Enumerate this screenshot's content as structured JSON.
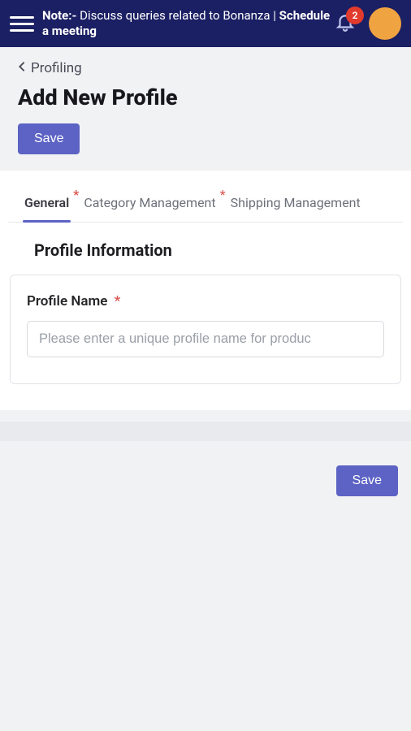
{
  "topbar": {
    "note_prefix": "Note:- ",
    "note_text": "Discuss queries related to Bonanza | ",
    "schedule_label": "Schedule a meeting",
    "notification_count": "2"
  },
  "breadcrumb": {
    "label": "Profiling"
  },
  "page": {
    "title": "Add New Profile"
  },
  "buttons": {
    "save": "Save"
  },
  "tabs": [
    {
      "label": "General",
      "required": true,
      "active": true
    },
    {
      "label": "Category Management",
      "required": true,
      "active": false
    },
    {
      "label": "Shipping Management",
      "required": false,
      "active": false
    }
  ],
  "section": {
    "title": "Profile Information"
  },
  "fields": {
    "profile_name": {
      "label": "Profile Name",
      "required_mark": "*",
      "placeholder": "Please enter a unique profile name for produc",
      "value": ""
    }
  }
}
